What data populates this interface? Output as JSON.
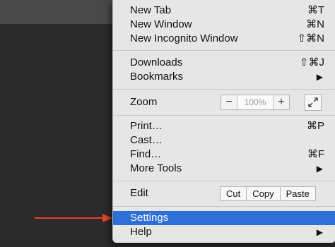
{
  "menu": {
    "new_tab": {
      "label": "New Tab",
      "shortcut": "⌘T"
    },
    "new_window": {
      "label": "New Window",
      "shortcut": "⌘N"
    },
    "new_incognito": {
      "label": "New Incognito Window",
      "shortcut": "⇧⌘N"
    },
    "downloads": {
      "label": "Downloads",
      "shortcut": "⇧⌘J"
    },
    "bookmarks": {
      "label": "Bookmarks",
      "submenu": "▶"
    },
    "zoom": {
      "label": "Zoom",
      "minus": "−",
      "value": "100%",
      "plus": "+",
      "fullscreen_icon": "fullscreen-icon"
    },
    "print": {
      "label": "Print…",
      "shortcut": "⌘P"
    },
    "cast": {
      "label": "Cast…"
    },
    "find": {
      "label": "Find…",
      "shortcut": "⌘F"
    },
    "more_tools": {
      "label": "More Tools",
      "submenu": "▶"
    },
    "edit": {
      "label": "Edit",
      "cut": "Cut",
      "copy": "Copy",
      "paste": "Paste"
    },
    "settings": {
      "label": "Settings"
    },
    "help": {
      "label": "Help",
      "submenu": "▶"
    }
  },
  "colors": {
    "highlight": "#2d6fd6",
    "arrow": "#e8402c",
    "menu_bg": "#e6e6e6"
  }
}
